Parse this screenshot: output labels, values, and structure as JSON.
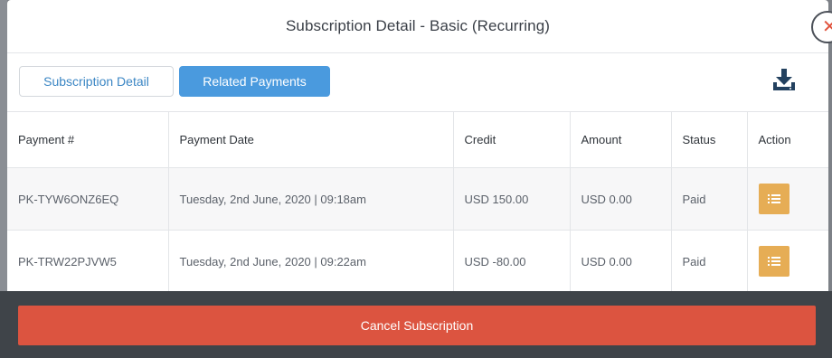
{
  "modal": {
    "title": "Subscription Detail - Basic (Recurring)",
    "close_glyph": "✕"
  },
  "tabs": [
    {
      "label": "Subscription Detail",
      "active": false
    },
    {
      "label": "Related Payments",
      "active": true
    }
  ],
  "toolbar": {
    "download_icon": "download-icon"
  },
  "table": {
    "columns": [
      "Payment #",
      "Payment Date",
      "Credit",
      "Amount",
      "Status",
      "Action"
    ],
    "rows": [
      {
        "payment": "PK-TYW6ONZ6EQ",
        "date": "Tuesday, 2nd June, 2020 | 09:18am",
        "credit": "USD 150.00",
        "amount": "USD 0.00",
        "status": "Paid",
        "action_icon": "list-icon"
      },
      {
        "payment": "PK-TRW22PJVW5",
        "date": "Tuesday, 2nd June, 2020 | 09:22am",
        "credit": "USD -80.00",
        "amount": "USD 0.00",
        "status": "Paid",
        "action_icon": "list-icon"
      }
    ]
  },
  "footer": {
    "cancel_label": "Cancel Subscription"
  },
  "colors": {
    "accent_blue": "#4a9ade",
    "action_orange": "#e6ad55",
    "cancel_red": "#dc5440",
    "close_red": "#e0533d"
  }
}
